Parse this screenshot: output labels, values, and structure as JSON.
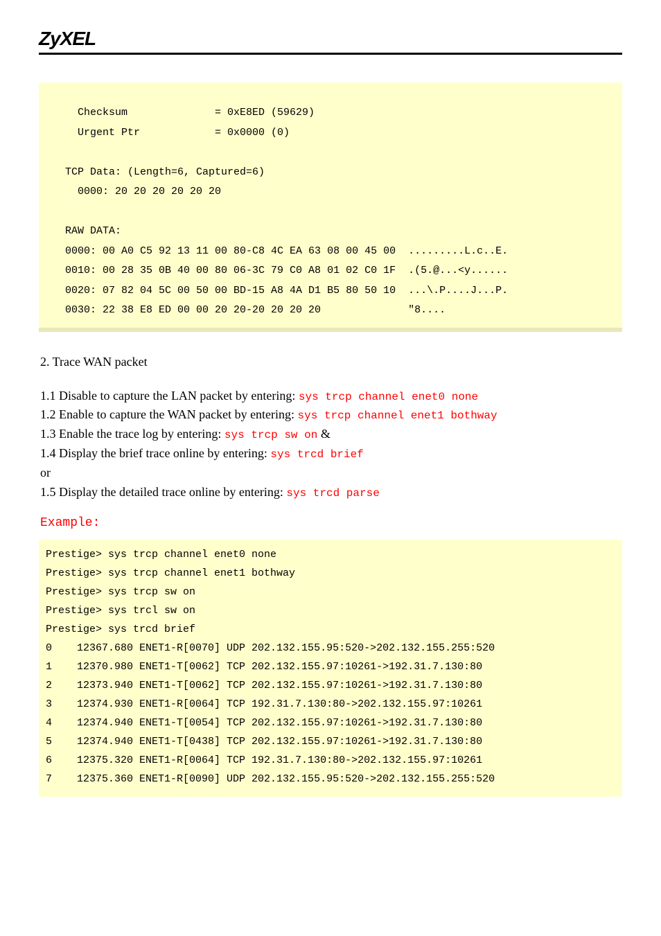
{
  "header": {
    "logo": "ZyXEL"
  },
  "top_box": {
    "l1": "    Checksum              = 0xE8ED (59629)",
    "l2": "    Urgent Ptr            = 0x0000 (0)",
    "l3": "",
    "l4": "  TCP Data: (Length=6, Captured=6)",
    "l5": "    0000: 20 20 20 20 20 20",
    "l6": "",
    "l7": "  RAW DATA:",
    "l8": "  0000: 00 A0 C5 92 13 11 00 80-C8 4C EA 63 08 00 45 00  .........L.c..E.",
    "l9": "  0010: 00 28 35 0B 40 00 80 06-3C 79 C0 A8 01 02 C0 1F  .(5.@...<y......",
    "l10": "  0020: 07 82 04 5C 00 50 00 BD-15 A8 4A D1 B5 80 50 10  ...\\.P....J...P.",
    "l11": "  0030: 22 38 E8 ED 00 00 20 20-20 20 20 20              \"8...."
  },
  "section_title": "2. Trace WAN packet",
  "steps": {
    "s1a": "1.1 Disable to capture the LAN packet by entering: ",
    "s1b": "sys trcp channel enet0 none",
    "s2a": "1.2 Enable to capture the WAN packet by entering: ",
    "s2b": "sys trcp channel enet1 bothway",
    "s3a": "1.3 Enable the trace log by entering: ",
    "s3b": "sys trcp sw on",
    "s3c": " & ",
    "s4a": "1.4 Display the brief trace online by entering: ",
    "s4b": "sys trcd brief",
    "or": "or",
    "s5a": "1.5 Display the detailed trace online by entering: ",
    "s5b": "sys trcd parse"
  },
  "example_label": "Example:",
  "bottom_box": {
    "l1": "Prestige> sys trcp channel enet0 none",
    "l2": "Prestige> sys trcp channel enet1 bothway",
    "l3": "Prestige> sys trcp sw on",
    "l4": "Prestige> sys trcl sw on",
    "l5": "Prestige> sys trcd brief",
    "l6": "0    12367.680 ENET1-R[0070] UDP 202.132.155.95:520->202.132.155.255:520",
    "l7": "1    12370.980 ENET1-T[0062] TCP 202.132.155.97:10261->192.31.7.130:80",
    "l8": "2    12373.940 ENET1-T[0062] TCP 202.132.155.97:10261->192.31.7.130:80",
    "l9": "3    12374.930 ENET1-R[0064] TCP 192.31.7.130:80->202.132.155.97:10261",
    "l10": "4    12374.940 ENET1-T[0054] TCP 202.132.155.97:10261->192.31.7.130:80",
    "l11": "5    12374.940 ENET1-T[0438] TCP 202.132.155.97:10261->192.31.7.130:80",
    "l12": "6    12375.320 ENET1-R[0064] TCP 192.31.7.130:80->202.132.155.97:10261",
    "l13": "7    12375.360 ENET1-R[0090] UDP 202.132.155.95:520->202.132.155.255:520"
  }
}
